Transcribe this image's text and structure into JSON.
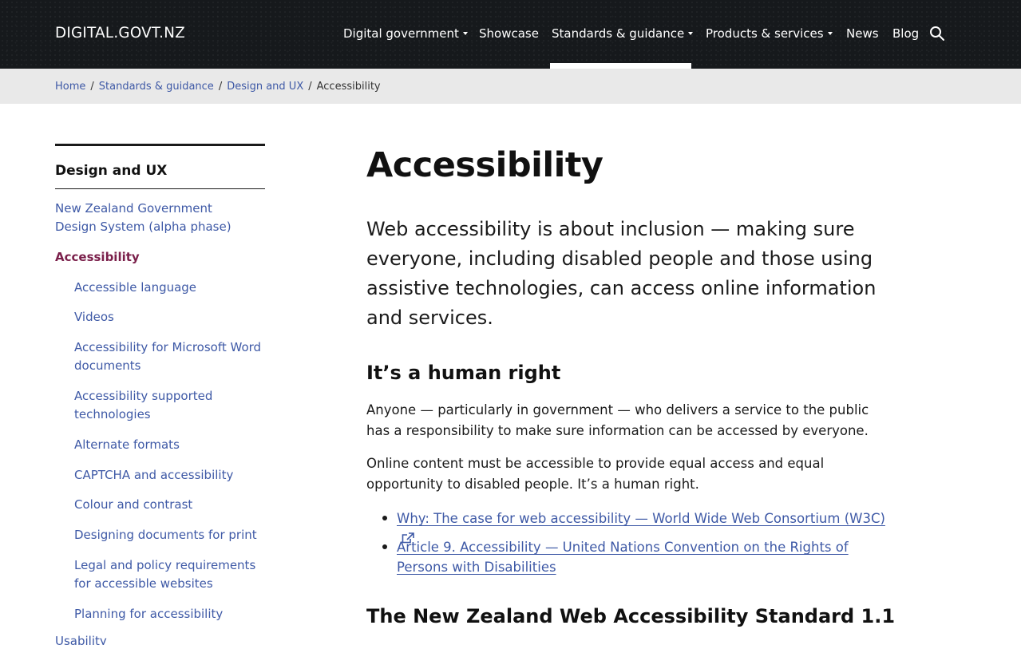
{
  "header": {
    "logo": "DIGITAL.GOVT.NZ",
    "nav": [
      {
        "label": "Digital government",
        "has_dropdown": true
      },
      {
        "label": "Showcase",
        "has_dropdown": false
      },
      {
        "label": "Standards & guidance",
        "has_dropdown": true,
        "active": true
      },
      {
        "label": "Products & services",
        "has_dropdown": true
      },
      {
        "label": "News",
        "has_dropdown": false
      },
      {
        "label": "Blog",
        "has_dropdown": false
      }
    ],
    "search_icon": "search-icon"
  },
  "breadcrumb": {
    "items": [
      "Home",
      "Standards & guidance",
      "Design and UX"
    ],
    "current": "Accessibility",
    "separator": "/"
  },
  "sidebar": {
    "title": "Design and UX",
    "items": [
      {
        "label": "New Zealand Government Design System (alpha phase)",
        "level": 1
      },
      {
        "label": "Accessibility",
        "level": 1,
        "active": true
      },
      {
        "label": "Accessible language",
        "level": 2
      },
      {
        "label": "Videos",
        "level": 2
      },
      {
        "label": "Accessibility for Microsoft Word documents",
        "level": 2
      },
      {
        "label": "Accessibility supported technologies",
        "level": 2
      },
      {
        "label": "Alternate formats",
        "level": 2
      },
      {
        "label": "CAPTCHA and accessibility",
        "level": 2
      },
      {
        "label": "Colour and contrast",
        "level": 2
      },
      {
        "label": "Designing documents for print",
        "level": 2
      },
      {
        "label": "Legal and policy requirements for accessible websites",
        "level": 2
      },
      {
        "label": "Planning for accessibility",
        "level": 2
      },
      {
        "label": "Usability",
        "level": 1
      }
    ]
  },
  "main": {
    "title": "Accessibility",
    "lead": "Web accessibility is about inclusion — making sure everyone, including disabled people and those using assistive technologies, can access online information and services.",
    "section1": {
      "heading": "It’s a human right",
      "para1": "Anyone — particularly in government — who delivers a service to the public has a responsibility to make sure information can be accessed by everyone.",
      "para2": "Online content must be accessible to provide equal access and equal opportunity to disabled people. It’s a human right.",
      "links": [
        {
          "label": "Why: The case for web accessibility — World Wide Web Consortium (W3C)",
          "external": true
        },
        {
          "label": "Article 9. Accessibility — United Nations Convention on the Rights of Persons with Disabilities",
          "external": false
        }
      ]
    },
    "section2": {
      "heading": "The New Zealand Web Accessibility Standard 1.1"
    }
  },
  "colors": {
    "header_bg": "#16191c",
    "link": "#3e59a6",
    "active_sidebar": "#7a1f4a",
    "breadcrumb_bg": "#e9e9e9"
  }
}
